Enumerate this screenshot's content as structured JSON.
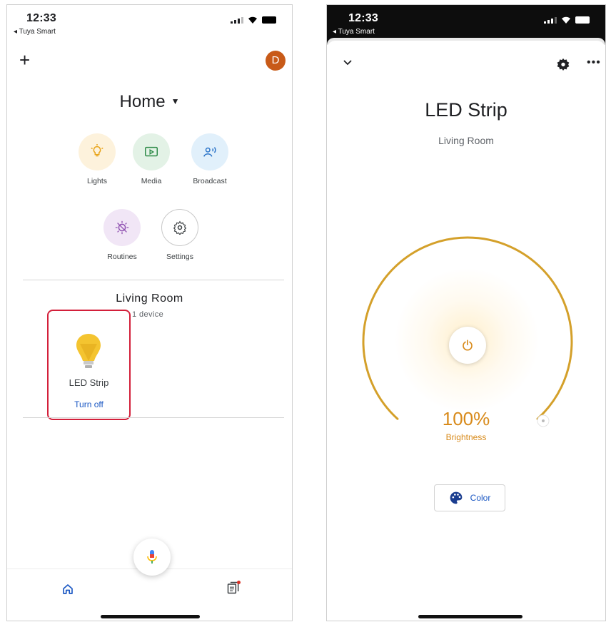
{
  "left": {
    "status": {
      "time": "12:33",
      "back_label": "◂ Tuya Smart"
    },
    "header": {
      "add_label": "+",
      "avatar_letter": "D",
      "title": "Home"
    },
    "shortcuts": [
      {
        "label": "Lights",
        "icon": "lightbulb-icon",
        "bg": "#fdf2dc",
        "fg": "#e8a317"
      },
      {
        "label": "Media",
        "icon": "media-play-icon",
        "bg": "#e3f2e6",
        "fg": "#2e8b48"
      },
      {
        "label": "Broadcast",
        "icon": "broadcast-icon",
        "bg": "#e1f0fb",
        "fg": "#2a73c8"
      },
      {
        "label": "Routines",
        "icon": "routines-icon",
        "bg": "#f1e6f6",
        "fg": "#8e4fb0"
      },
      {
        "label": "Settings",
        "icon": "gear-icon",
        "bg": "#ffffff",
        "fg": "#3c4043"
      }
    ],
    "room": {
      "title": "Living Room",
      "subtitle": "1 device",
      "device": {
        "name": "LED Strip",
        "action": "Turn off",
        "icon": "bulb-icon"
      }
    },
    "nav": {
      "home_icon": "home-icon",
      "feed_icon": "feed-icon"
    }
  },
  "right": {
    "status": {
      "time": "12:33",
      "back_label": "◂ Tuya Smart"
    },
    "device_title": "LED Strip",
    "room": "Living Room",
    "brightness": {
      "value": "100%",
      "label": "Brightness",
      "fraction": 1.0
    },
    "color_button": "Color"
  },
  "colors": {
    "accent_orange": "#d88a1a",
    "arc_gold": "#d4a02a",
    "link_blue": "#1a57c3",
    "highlight_red": "#d31f3a",
    "avatar": "#c85a18"
  }
}
